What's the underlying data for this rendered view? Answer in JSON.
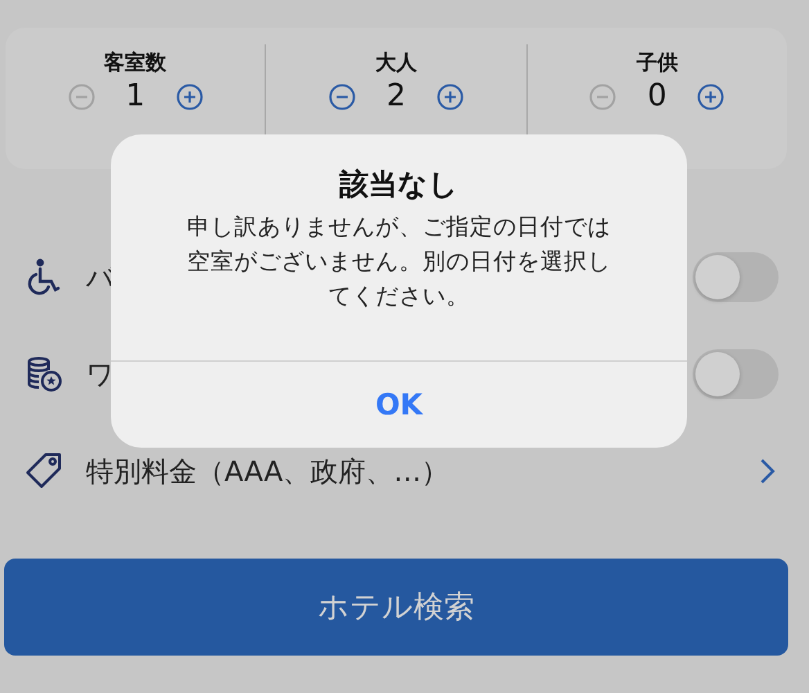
{
  "steppers": [
    {
      "label": "客室数",
      "value": "1",
      "minus_disabled": true
    },
    {
      "label": "大人",
      "value": "2",
      "minus_disabled": false
    },
    {
      "label": "子供",
      "value": "0",
      "minus_disabled": true
    }
  ],
  "options": [
    {
      "kind": "toggle",
      "label": "バ",
      "on": false
    },
    {
      "kind": "toggle",
      "label": "ワ",
      "on": false
    },
    {
      "kind": "link",
      "label": "特別料金（AAA、政府、…）"
    }
  ],
  "search_button": "ホテル検索",
  "alert": {
    "title": "該当なし",
    "message": "申し訳ありませんが、ご指定の日付では空室がございません。別の日付を選択してください。",
    "button": "OK"
  }
}
